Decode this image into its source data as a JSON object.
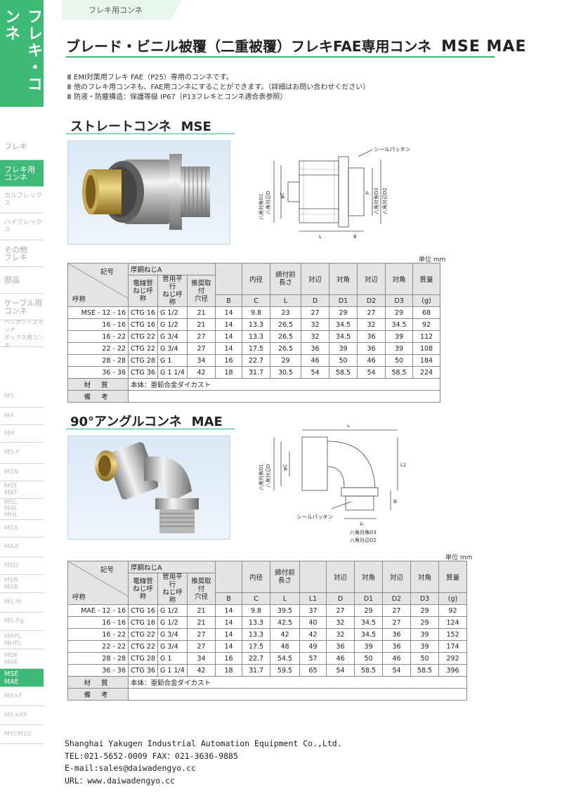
{
  "sidebar": {
    "title": "フレキ・コンネ",
    "items": [
      {
        "label": "フレキ",
        "top": 0
      },
      {
        "label": "フレキ用\nコンネ"
      },
      {
        "label": "カルフレックス"
      },
      {
        "label": "ハイフレックス"
      },
      {
        "label": "その他\nフレキ"
      },
      {
        "label": "部品"
      },
      {
        "label": "ケーブル用\nコンネ"
      },
      {
        "label": "ペンダントスイッチ\nボックス用コンネ"
      }
    ],
    "models": [
      "MS",
      "MA",
      "MH",
      "MS-F",
      "MSN",
      "MST\nMAT",
      "MSL\nMAL\nMHL",
      "MSA",
      "MAA",
      "MSU",
      "MSR\nMAR",
      "MS-M",
      "MS-Pg",
      "MAPL\nMHPL",
      "MSK\nMAK",
      "MSE\nMAE",
      "MS×F",
      "MS×AY",
      "MYCM10"
    ]
  },
  "header": {
    "tab": "フレキ用コンネ",
    "title": "ブレード・ビニル被覆（二重被覆）フレキFAE専用コンネ",
    "models": "MSE  MAE"
  },
  "bullets": [
    "EMI対策用フレキ FAE（P25）専用のコンネです。",
    "他のフレキ用コンネも、FAE用コンネにすることができます。（詳細はお問い合わせください）",
    "防液・防塵構造：保護等級 IP67（P13フレキとコンネ適合表参照）"
  ],
  "mse": {
    "title": "ストレートコンネ",
    "model": "MSE",
    "diagram": {
      "seal": "シールパッキン",
      "d1": "八角対角D1",
      "d": "八角対辺D",
      "c": "φC",
      "a": "A",
      "d3": "八角対角D3",
      "d2": "八角対辺D2",
      "l": "L",
      "b": "B"
    },
    "unit": "単位 mm",
    "table": {
      "h_kigou": "記号",
      "h_name": "呼称",
      "h_thread": "厚鋼ねじA",
      "h_t1": "電線管\nねじ呼称",
      "h_t2": "管用平行\nねじ呼称",
      "h_t3": "推奨取付\n穴径",
      "h_naikei": "内径",
      "h_len": "締付前\n長さ",
      "h_taihen": "対辺",
      "h_taikaku": "対角",
      "h_taihen2": "対辺",
      "h_taikaku2": "対角",
      "h_mass": "質量",
      "s_b": "B",
      "s_c": "C",
      "s_l": "L",
      "s_d": "D",
      "s_d1": "D1",
      "s_d2": "D2",
      "s_d3": "D3",
      "s_g": "(g)",
      "rows": [
        [
          "MSE -  12 - 16",
          "CTG 16",
          "G 1/2",
          "21",
          "14",
          "9.8",
          "23",
          "27",
          "29",
          "27",
          "29",
          "68"
        ],
        [
          "16 - 16",
          "CTG 16",
          "G 1/2",
          "21",
          "14",
          "13.3",
          "26.5",
          "32",
          "34.5",
          "32",
          "34.5",
          "92"
        ],
        [
          "16 - 22",
          "CTG 22",
          "G 3/4",
          "27",
          "14",
          "13.3",
          "26.5",
          "32",
          "34.5",
          "36",
          "39",
          "112"
        ],
        [
          "22 - 22",
          "CTG 22",
          "G 3/4",
          "27",
          "14",
          "17.5",
          "26.5",
          "36",
          "39",
          "36",
          "39",
          "108"
        ],
        [
          "28 - 28",
          "CTG 28",
          "G  1",
          "34",
          "16",
          "22.7",
          "29",
          "46",
          "50",
          "46",
          "50",
          "184"
        ],
        [
          "36 - 36",
          "CTG 36",
          "G 1 1/4",
          "42",
          "18",
          "31.7",
          "30.5",
          "54",
          "58.5",
          "54",
          "58.5",
          "224"
        ]
      ],
      "material_label": "材 質",
      "material": "本体：亜鉛合金ダイカスト",
      "remarks_label": "備 考",
      "remarks": ""
    }
  },
  "mae": {
    "title": "90°アングルコンネ",
    "model": "MAE",
    "diagram": {
      "seal": "シールパッキン",
      "d1": "八角対角D1",
      "d": "八角対辺D",
      "c": "φC",
      "a": "A",
      "d3": "八角対角D3",
      "d2": "八角対辺D2",
      "l": "L",
      "l1": "L1",
      "b": "B"
    },
    "unit": "単位 mm",
    "table": {
      "h_kigou": "記号",
      "h_name": "呼称",
      "h_thread": "厚鋼ねじA",
      "h_t1": "電線管\nねじ呼称",
      "h_t2": "管用平行\nねじ呼称",
      "h_t3": "推奨取付\n穴径",
      "h_naikei": "内径",
      "h_len": "締付前\n長さ",
      "h_taihen": "対辺",
      "h_taikaku": "対角",
      "h_taihen2": "対辺",
      "h_taikaku2": "対角",
      "h_mass": "質量",
      "s_b": "B",
      "s_c": "C",
      "s_l": "L",
      "s_l1": "L1",
      "s_d": "D",
      "s_d1": "D1",
      "s_d2": "D2",
      "s_d3": "D3",
      "s_g": "(g)",
      "rows": [
        [
          "MAE -  12 - 16",
          "CTG 16",
          "G 1/2",
          "21",
          "14",
          "9.8",
          "39.5",
          "37",
          "27",
          "29",
          "27",
          "29",
          "92"
        ],
        [
          "16 - 16",
          "CTG 16",
          "G 1/2",
          "21",
          "14",
          "13.3",
          "42.5",
          "40",
          "32",
          "34.5",
          "27",
          "29",
          "124"
        ],
        [
          "16 - 22",
          "CTG 22",
          "G 3/4",
          "27",
          "14",
          "13.3",
          "42",
          "42",
          "32",
          "34.5",
          "36",
          "39",
          "152"
        ],
        [
          "22 - 22",
          "CTG 22",
          "G 3/4",
          "27",
          "14",
          "17.5",
          "48",
          "49",
          "36",
          "39",
          "36",
          "39",
          "174"
        ],
        [
          "28 - 28",
          "CTG 28",
          "G  1",
          "34",
          "16",
          "22.7",
          "54.5",
          "57",
          "46",
          "50",
          "46",
          "50",
          "292"
        ],
        [
          "36 - 36",
          "CTG 36",
          "G 1 1/4",
          "42",
          "18",
          "31.7",
          "59.5",
          "65",
          "54",
          "58.5",
          "54",
          "58.5",
          "396"
        ]
      ],
      "material_label": "材 質",
      "material": "本体：亜鉛合金ダイカスト",
      "remarks_label": "備 考",
      "remarks": ""
    }
  },
  "footer": {
    "company": "Shanghai Yakugen Industrial Automation Equipment Co.,Ltd.",
    "tel": "TEL:021-5652-0009   FAX：021-3636-9885",
    "email": "E-mail:sales@daiwadengyo.cc",
    "url": "URL：www.daiwadengyo.cc"
  }
}
